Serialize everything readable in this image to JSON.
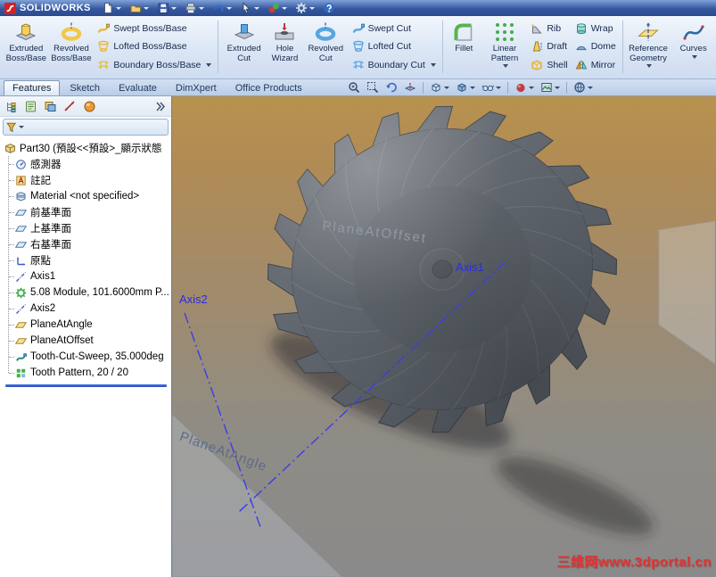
{
  "titlebar": {
    "brand": "SOLIDWORKS",
    "icons": [
      "new-document-icon",
      "open-icon",
      "save-icon",
      "print-icon",
      "undo-icon",
      "select-icon",
      "rebuild-icon",
      "options-icon",
      "help-icon"
    ]
  },
  "ribbon": {
    "large": [
      {
        "label": "Extruded Boss/Base"
      },
      {
        "label": "Revolved Boss/Base"
      },
      {
        "label": "Extruded Cut"
      },
      {
        "label": "Hole Wizard"
      },
      {
        "label": "Revolved Cut"
      },
      {
        "label": "Fillet"
      },
      {
        "label": "Linear Pattern"
      },
      {
        "label": "Reference Geometry"
      },
      {
        "label": "Curves"
      }
    ],
    "small": [
      {
        "label": "Swept Boss/Base"
      },
      {
        "label": "Lofted Boss/Base"
      },
      {
        "label": "Boundary Boss/Base"
      },
      {
        "label": "Swept Cut"
      },
      {
        "label": "Lofted Cut"
      },
      {
        "label": "Boundary Cut"
      },
      {
        "label": "Rib"
      },
      {
        "label": "Draft"
      },
      {
        "label": "Shell"
      },
      {
        "label": "Wrap"
      },
      {
        "label": "Dome"
      },
      {
        "label": "Mirror"
      }
    ]
  },
  "tabs": {
    "active": "Features",
    "items": [
      {
        "label": "Features"
      },
      {
        "label": "Sketch"
      },
      {
        "label": "Evaluate"
      },
      {
        "label": "DimXpert"
      },
      {
        "label": "Office Products"
      }
    ]
  },
  "feature_tree": {
    "items": [
      {
        "icon": "part-icon",
        "label": "Part30 (預設<<預設>_顯示狀態"
      },
      {
        "icon": "sensors-icon",
        "label": "感測器"
      },
      {
        "icon": "annotations-icon",
        "label": "註記"
      },
      {
        "icon": "material-icon",
        "label": "Material <not specified>"
      },
      {
        "icon": "plane-icon",
        "label": "前基準面"
      },
      {
        "icon": "plane-icon",
        "label": "上基準面"
      },
      {
        "icon": "plane-icon",
        "label": "右基準面"
      },
      {
        "icon": "origin-icon",
        "label": "原點"
      },
      {
        "icon": "axis-icon",
        "label": "Axis1"
      },
      {
        "icon": "gear-feature-icon",
        "label": "5.08 Module, 101.6000mm P..."
      },
      {
        "icon": "axis-icon",
        "label": "Axis2"
      },
      {
        "icon": "ref-plane-icon",
        "label": "PlaneAtAngle"
      },
      {
        "icon": "ref-plane-icon",
        "label": "PlaneAtOffset"
      },
      {
        "icon": "sweep-cut-icon",
        "label": "Tooth-Cut-Sweep, 35.000deg"
      },
      {
        "icon": "pattern-icon",
        "label": "Tooth Pattern, 20 / 20"
      }
    ]
  },
  "viewport": {
    "toolbar_icons": [
      "zoom-fit-icon",
      "zoom-area-icon",
      "previous-view-icon",
      "section-view-icon",
      "view-orientation-icon",
      "display-style-icon",
      "hide-show-items-icon",
      "edit-appearance-icon",
      "apply-scene-icon",
      "view-settings-icon"
    ],
    "labels": {
      "axis1": "Axis1",
      "axis2": "Axis2",
      "plane_at_offset": "PlaneAtOffset",
      "plane_at_angle": "PlaneAtAngle"
    },
    "watermark": "三维网www.3dportal.cn"
  },
  "colors": {
    "axis_label": "#2c2ce0",
    "watermark": "#e23333",
    "gear_body": "#5a6068",
    "viewport_gradient_top": "#b8924f",
    "viewport_gradient_bottom": "#8a8a8a"
  }
}
